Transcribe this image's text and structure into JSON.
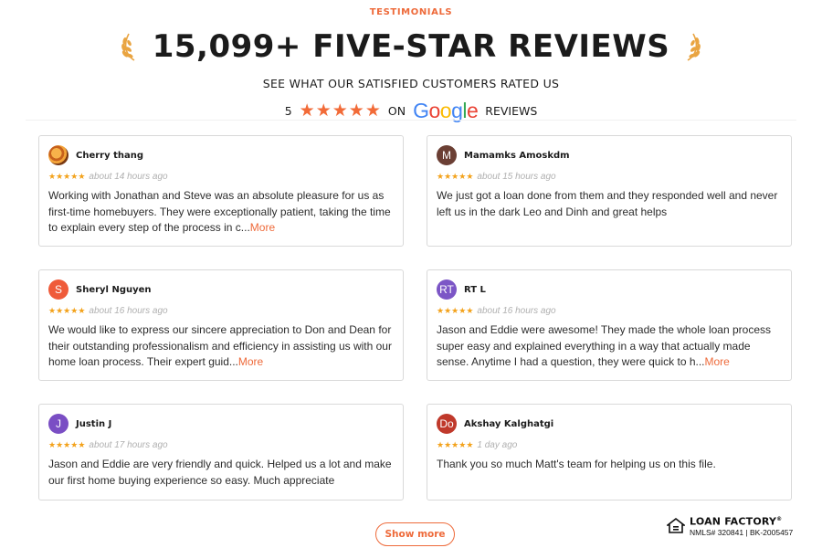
{
  "header": {
    "eyebrow": "TESTIMONIALS",
    "title": "15,099+ FIVE-STAR REVIEWS",
    "subtitle": "SEE WHAT OUR SATISFIED CUSTOMERS RATED US",
    "rating_value": "5",
    "rating_stars": 5,
    "rating_on": "ON",
    "rating_platform": "Google",
    "rating_suffix": "REVIEWS"
  },
  "colors": {
    "accent": "#ee6a3a",
    "star_small": "#f3a21b",
    "laurel": "#e9a441"
  },
  "reviews": [
    {
      "name": "Cherry thang",
      "avatar_letter": "",
      "avatar_color": "#e8852a",
      "avatar_icon": "bee-photo-avatar",
      "stars": 5,
      "time": "about 14 hours ago",
      "text": "Working with Jonathan and Steve was an absolute pleasure for us as first-time homebuyers. They were exceptionally patient, taking the time to explain every step of the process in c...",
      "more": "More"
    },
    {
      "name": "Mamamks Amoskdm",
      "avatar_letter": "M",
      "avatar_color": "#6b3f34",
      "stars": 5,
      "time": "about 15 hours ago",
      "text": "We just got a loan done from them and they responded well and never left us in the dark Leo and Dinh and great helps",
      "more": ""
    },
    {
      "name": "Sheryl Nguyen",
      "avatar_letter": "S",
      "avatar_color": "#ef5b3a",
      "stars": 5,
      "time": "about 16 hours ago",
      "text": "We would like to express our sincere appreciation to Don and Dean for their outstanding professionalism and efficiency in assisting us with our home loan process. Their expert guid...",
      "more": "More"
    },
    {
      "name": "RT L",
      "avatar_letter": "RT",
      "avatar_color": "#7c56c6",
      "stars": 5,
      "time": "about 16 hours ago",
      "text": "Jason and Eddie were awesome! They made the whole loan process super easy and explained everything in a way that actually made sense. Anytime I had a question, they were quick to h...",
      "more": "More"
    },
    {
      "name": "Justin J",
      "avatar_letter": "J",
      "avatar_color": "#7a4ec4",
      "stars": 5,
      "time": "about 17 hours ago",
      "text": "Jason and Eddie are very friendly and quick. Helped us a lot and make our first home buying experience so easy. Much appreciate",
      "more": ""
    },
    {
      "name": "Akshay Kalghatgi",
      "avatar_letter": "Do",
      "avatar_color": "#c0392b",
      "stars": 5,
      "time": "1 day ago",
      "text": "Thank you so much Matt's team for helping us on this file.",
      "more": ""
    }
  ],
  "show_more_label": "Show more",
  "footer_badge": {
    "icon": "equal-housing-lender-icon",
    "brand": "LOAN FACTORY",
    "brand_mark": "®",
    "license": "NMLS# 320841 | BK-2005457"
  }
}
